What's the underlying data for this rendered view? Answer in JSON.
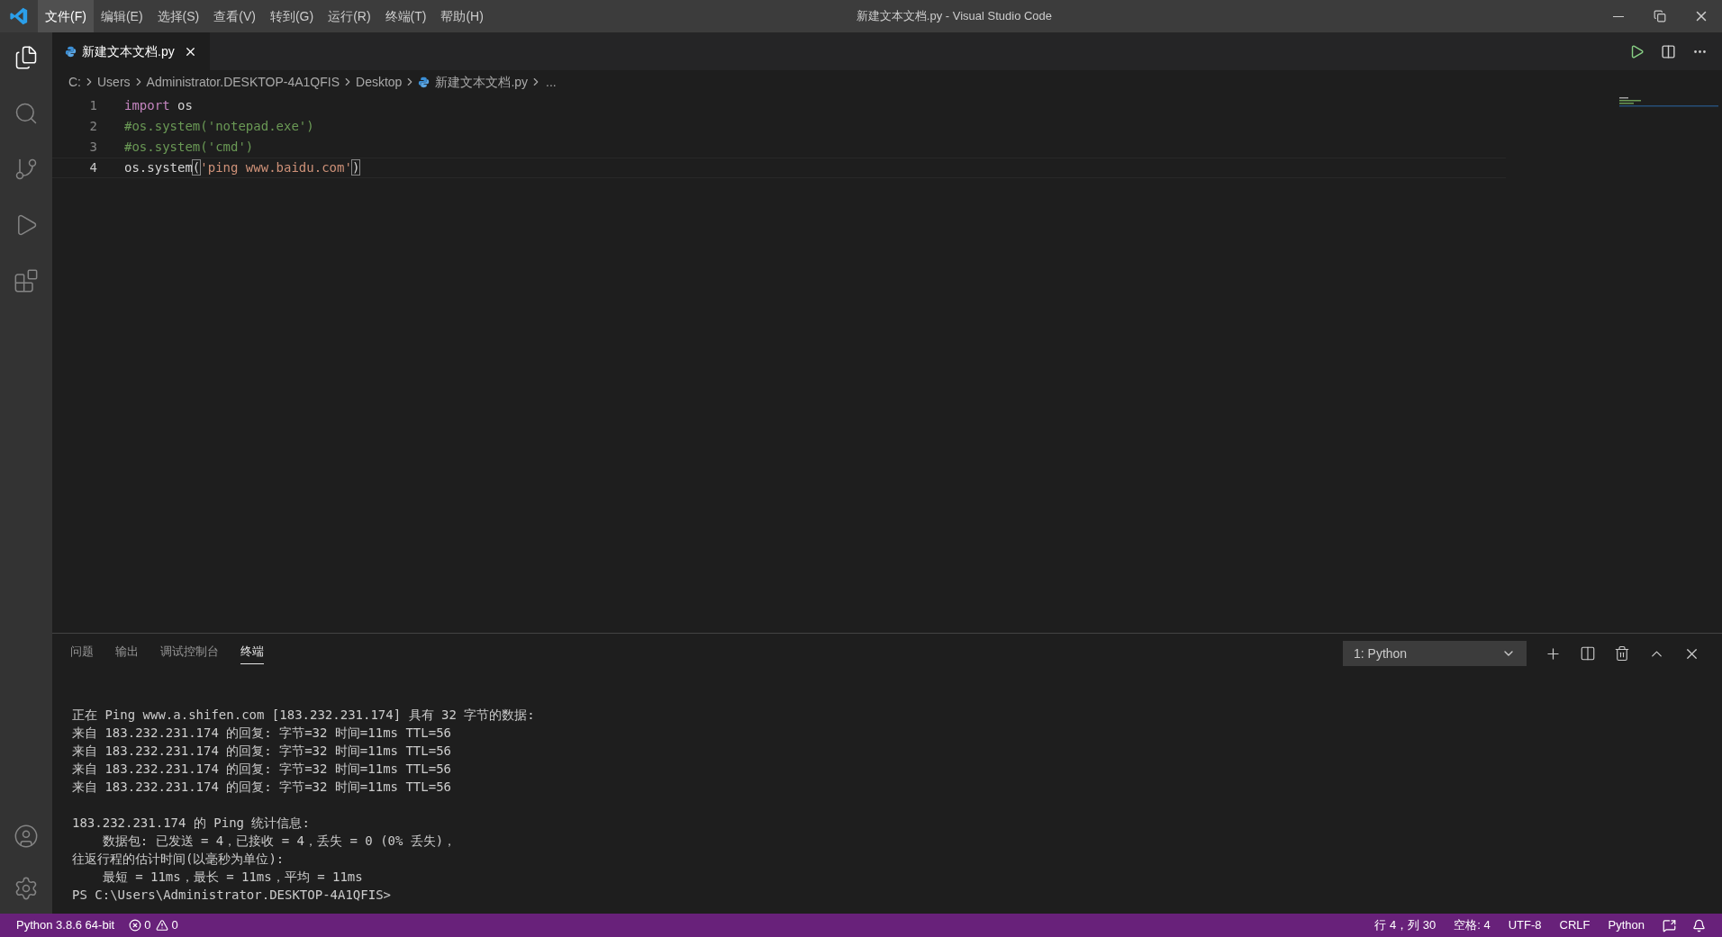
{
  "window": {
    "title": "新建文本文档.py - Visual Studio Code"
  },
  "menu": [
    {
      "label": "文件(F)",
      "selected": true
    },
    {
      "label": "编辑(E)",
      "selected": false
    },
    {
      "label": "选择(S)",
      "selected": false
    },
    {
      "label": "查看(V)",
      "selected": false
    },
    {
      "label": "转到(G)",
      "selected": false
    },
    {
      "label": "运行(R)",
      "selected": false
    },
    {
      "label": "终端(T)",
      "selected": false
    },
    {
      "label": "帮助(H)",
      "selected": false
    }
  ],
  "editor_tabs": [
    {
      "label": "新建文本文档.py",
      "selected": true
    }
  ],
  "breadcrumb": [
    {
      "label": "C:",
      "kind": "folder"
    },
    {
      "label": "Users",
      "kind": "folder"
    },
    {
      "label": "Administrator.DESKTOP-4A1QFIS",
      "kind": "folder"
    },
    {
      "label": "Desktop",
      "kind": "folder"
    },
    {
      "label": "新建文本文档.py",
      "kind": "file"
    },
    {
      "label": "...",
      "kind": "more"
    }
  ],
  "code": [
    {
      "number": "1",
      "current": false,
      "tokens": [
        {
          "text": "import",
          "kind": "keyword"
        },
        {
          "text": " os",
          "kind": "plain"
        }
      ]
    },
    {
      "number": "2",
      "current": false,
      "tokens": [
        {
          "text": "#os.system('notepad.exe')",
          "kind": "comment"
        }
      ]
    },
    {
      "number": "3",
      "current": false,
      "tokens": [
        {
          "text": "#os.system('cmd')",
          "kind": "comment"
        }
      ]
    },
    {
      "number": "4",
      "current": true,
      "tokens": [
        {
          "text": "os.system",
          "kind": "plain"
        },
        {
          "text": "(",
          "kind": "bracket"
        },
        {
          "text": "'ping www.baidu.com",
          "kind": "string"
        },
        {
          "text": "'",
          "kind": "string"
        },
        {
          "text": ")",
          "kind": "bracket"
        }
      ]
    }
  ],
  "panel": {
    "tabs": [
      {
        "label": "问题",
        "selected": false
      },
      {
        "label": "输出",
        "selected": false
      },
      {
        "label": "调试控制台",
        "selected": false
      },
      {
        "label": "终端",
        "selected": true
      }
    ],
    "terminal_select": {
      "value": "1: Python"
    },
    "terminal_blocks": [
      [
        "正在 Ping www.a.shifen.com [183.232.231.174] 具有 32 字节的数据:",
        "来自 183.232.231.174 的回复: 字节=32 时间=11ms TTL=56",
        "来自 183.232.231.174 的回复: 字节=32 时间=11ms TTL=56",
        "来自 183.232.231.174 的回复: 字节=32 时间=11ms TTL=56",
        "来自 183.232.231.174 的回复: 字节=32 时间=11ms TTL=56"
      ],
      [
        "183.232.231.174 的 Ping 统计信息:",
        "    数据包: 已发送 = 4，已接收 = 4，丢失 = 0 (0% 丢失)，",
        "往返行程的估计时间(以毫秒为单位):",
        "    最短 = 11ms，最长 = 11ms，平均 = 11ms",
        "PS C:\\Users\\Administrator.DESKTOP-4A1QFIS>"
      ]
    ]
  },
  "status_bar": {
    "interpreter": "Python 3.8.6 64-bit",
    "errors": "0",
    "warnings": "0",
    "right": [
      "行 4，列 30",
      "空格: 4",
      "UTF-8",
      "CRLF",
      "Python"
    ]
  }
}
